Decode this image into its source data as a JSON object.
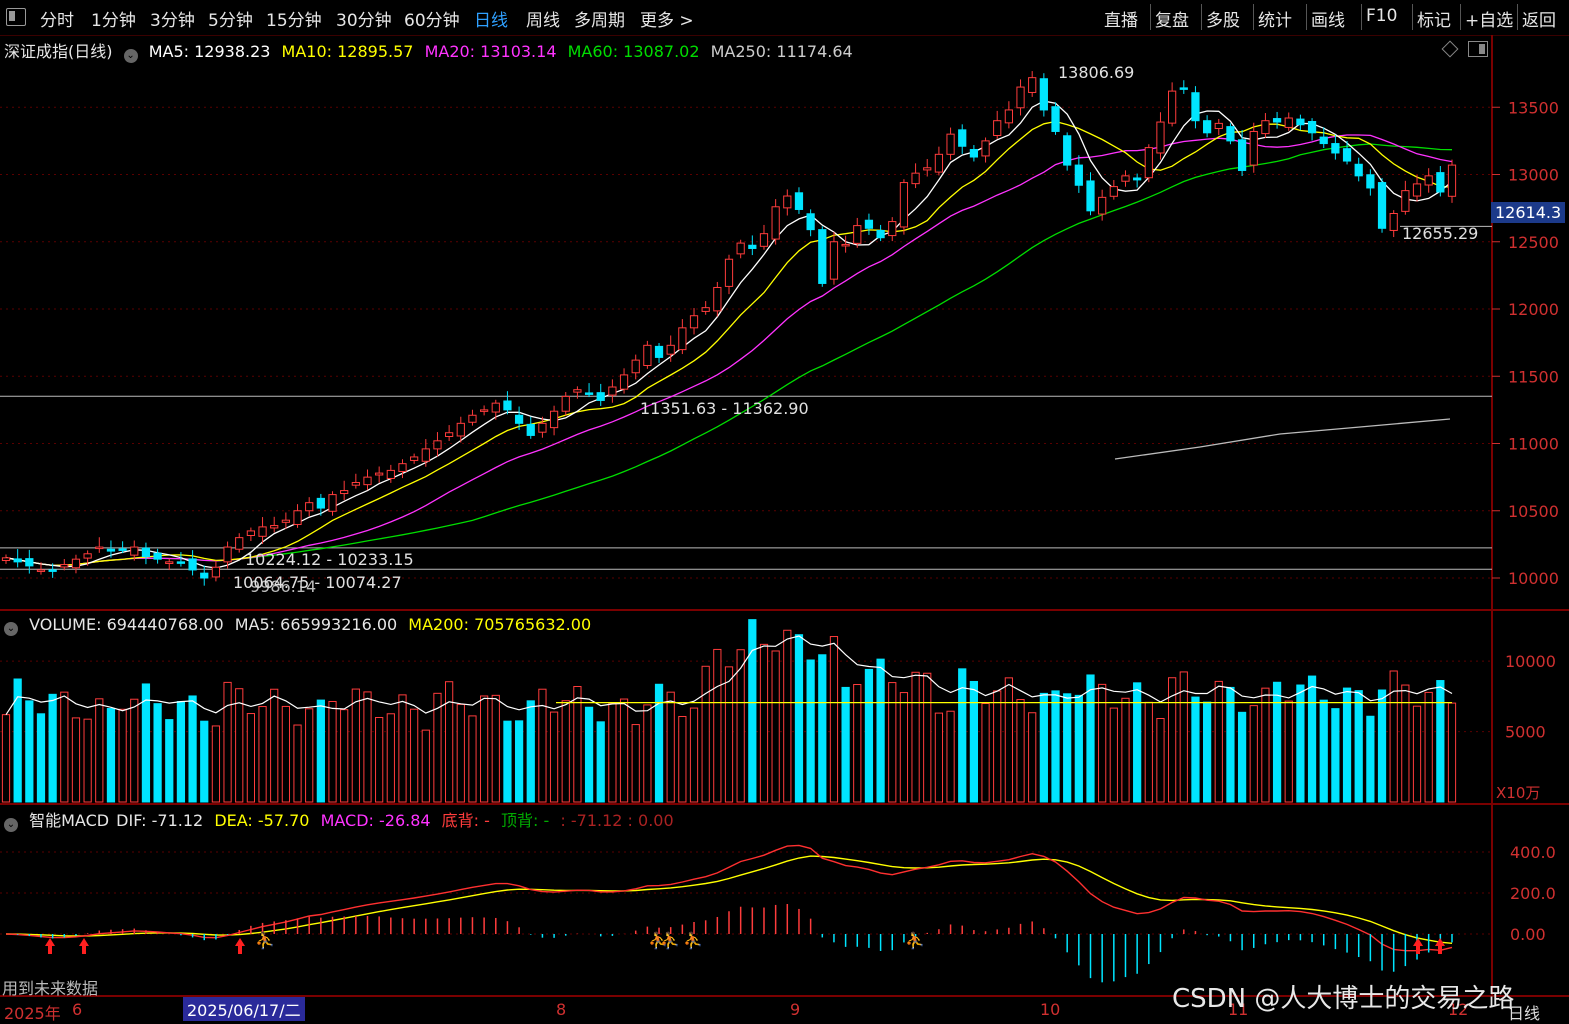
{
  "toolbar": {
    "periods": [
      "分时",
      "1分钟",
      "3分钟",
      "5分钟",
      "15分钟",
      "30分钟",
      "60分钟",
      "日线",
      "周线",
      "多周期",
      "更多 >"
    ],
    "active": "日线",
    "right": [
      "直播",
      "复盘",
      "多股",
      "统计",
      "画线",
      "F10",
      "标记",
      "+自选",
      "返回"
    ]
  },
  "main_legend": {
    "title": "深证成指(日线)",
    "ma5": "MA5: 12938.23",
    "ma10": "MA10: 12895.57",
    "ma20": "MA20: 13103.14",
    "ma60": "MA60: 13087.02",
    "ma250": "MA250: 11174.64"
  },
  "volume_legend": {
    "volume": "VOLUME: 694440768.00",
    "ma5": "MA5: 665993216.00",
    "ma200": "MA200: 705765632.00"
  },
  "macd_legend": {
    "name": "智能MACD",
    "dif": "DIF: -71.12",
    "dea": "DEA: -57.70",
    "macd": "MACD: -26.84",
    "bottom_div": "底背: -",
    "top_div": "顶背: -",
    "extra": ": -71.12 : 0.00"
  },
  "annotations": {
    "high": "13806.69",
    "low_right": "12655.29",
    "current": "12614.3",
    "zone_mid": "11351.63 - 11362.90",
    "zone_low1": "10224.12 - 10233.15",
    "zone_low2": "10064.75 - 10074.27",
    "zone_low2_overlap": "9986.14"
  },
  "footer": {
    "note": "用到未来数据",
    "selected_date": "2025/06/17/二",
    "watermark": "CSDN @人大博士的交易之路",
    "period_label": "日线",
    "dates": [
      {
        "label": "2025年"
      },
      {
        "label": "6"
      },
      {
        "label": "8"
      },
      {
        "label": "9"
      },
      {
        "label": "10"
      },
      {
        "label": "11"
      },
      {
        "label": "12"
      }
    ]
  },
  "colors": {
    "up": "#ff3c3c",
    "down": "#00e5ff",
    "ma5": "#ffffff",
    "ma10": "#ffff00",
    "ma20": "#ff33ff",
    "ma60": "#00dd00"
  },
  "chart_data": [
    {
      "type": "candlestick",
      "title": "深证成指(日线)",
      "ylim": [
        9700,
        13950
      ],
      "yticks": [
        10000,
        10500,
        11000,
        11500,
        12000,
        12500,
        13000,
        13500
      ],
      "ma5_last": 12938.23,
      "ma10_last": 12895.57,
      "ma20_last": 13103.14,
      "ma60_last": 13087.02,
      "ma250_last": 11174.64,
      "close": [
        10150,
        10120,
        10090,
        10060,
        10050,
        10100,
        10140,
        10180,
        10230,
        10200,
        10210,
        10230,
        10160,
        10140,
        10120,
        10110,
        10060,
        10000,
        10080,
        10230,
        10300,
        10350,
        10380,
        10390,
        10430,
        10500,
        10560,
        10520,
        10620,
        10650,
        10710,
        10750,
        10780,
        10800,
        10850,
        10900,
        10960,
        11020,
        11080,
        11150,
        11210,
        11250,
        11300,
        11250,
        11150,
        11060,
        11150,
        11240,
        11350,
        11400,
        11370,
        11320,
        11420,
        11510,
        11620,
        11730,
        11640,
        11730,
        11860,
        11950,
        12010,
        12160,
        12370,
        12490,
        12450,
        12560,
        12760,
        12840,
        12740,
        12590,
        12190,
        12500,
        12480,
        12620,
        12600,
        12530,
        12650,
        12940,
        13010,
        13050,
        13150,
        13300,
        13210,
        13130,
        13250,
        13400,
        13480,
        13650,
        13720,
        13480,
        13320,
        13070,
        12920,
        12730,
        12830,
        12910,
        12990,
        12960,
        13200,
        13390,
        13620,
        13640,
        13400,
        13310,
        13380,
        13250,
        13030,
        13320,
        13400,
        13390,
        13420,
        13370,
        13310,
        13230,
        13160,
        13100,
        12990,
        12900,
        12600,
        12710,
        12880,
        12930,
        12990,
        12870,
        13070
      ],
      "volume_unit": "X10万",
      "volume_yticks": [
        5000,
        10000
      ]
    },
    {
      "type": "line",
      "title": "智能MACD",
      "series": [
        {
          "name": "DIF",
          "last": -71.12
        },
        {
          "name": "DEA",
          "last": -57.7
        },
        {
          "name": "MACD",
          "last": -26.84
        }
      ],
      "yticks": [
        0.0,
        200.0,
        400.0
      ]
    }
  ]
}
